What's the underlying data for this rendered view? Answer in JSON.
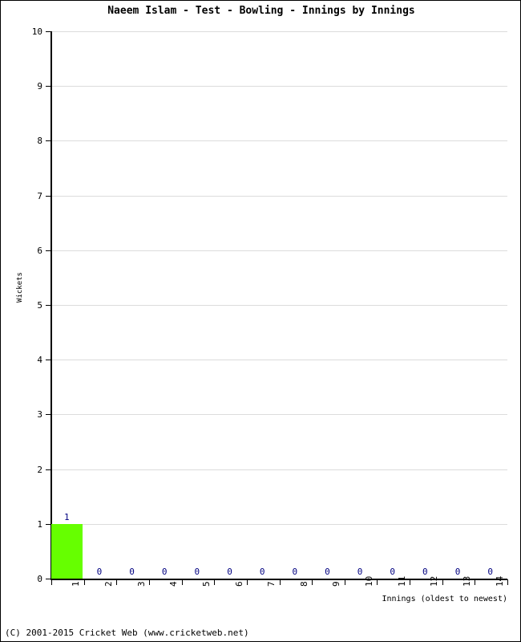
{
  "chart_data": {
    "type": "bar",
    "title": "Naeem Islam - Test - Bowling - Innings by Innings",
    "xlabel": "Innings (oldest to newest)",
    "ylabel": "Wickets",
    "categories": [
      "1",
      "2",
      "3",
      "4",
      "5",
      "6",
      "7",
      "8",
      "9",
      "10",
      "11",
      "12",
      "13",
      "14"
    ],
    "values": [
      1,
      0,
      0,
      0,
      0,
      0,
      0,
      0,
      0,
      0,
      0,
      0,
      0,
      0
    ],
    "value_labels": [
      "1",
      "0",
      "0",
      "0",
      "0",
      "0",
      "0",
      "0",
      "0",
      "0",
      "0",
      "0",
      "0",
      "0"
    ],
    "ylim": [
      0,
      10
    ],
    "y_ticks": [
      0,
      1,
      2,
      3,
      4,
      5,
      6,
      7,
      8,
      9,
      10
    ],
    "y_tick_labels": [
      "0",
      "1",
      "2",
      "3",
      "4",
      "5",
      "6",
      "7",
      "8",
      "9",
      "10"
    ],
    "grid": true,
    "legend": false,
    "bar_color": "#66FF00",
    "value_label_color": "#000080",
    "gridline_color": "#DCDCDC",
    "axis_color": "#000000"
  },
  "footer": {
    "copyright": "(C) 2001-2015 Cricket Web (www.cricketweb.net)"
  }
}
